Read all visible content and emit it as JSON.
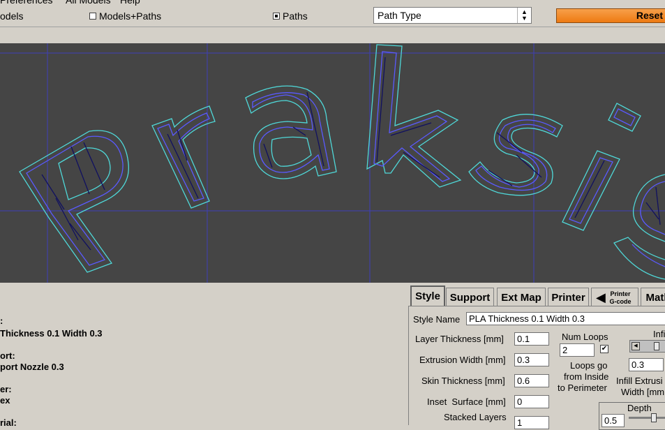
{
  "menu": {
    "items": [
      "Preferences",
      "All Models",
      "Help"
    ]
  },
  "toolbar": {
    "models_label": "odels",
    "models_paths_label": "Models+Paths",
    "paths_label": "Paths",
    "path_type_value": "Path Type",
    "reset_label": "Reset"
  },
  "info": {
    "lines": [
      ":",
      " Thickness 0.1 Width 0.3",
      "ort:",
      "port Nozzle 0.3",
      "er:",
      "ex",
      "rial:"
    ]
  },
  "tabs": [
    {
      "label": "Style"
    },
    {
      "label": "Support"
    },
    {
      "label": "Ext Map"
    },
    {
      "label": "Printer"
    },
    {
      "label": "Printer\nG-code"
    },
    {
      "label": "Math"
    }
  ],
  "style": {
    "style_name_label": "Style Name",
    "style_name_value": "PLA Thickness 0.1 Width 0.3",
    "layer_thickness_label": "Layer Thickness [mm]",
    "layer_thickness_value": "0.1",
    "extrusion_width_label": "Extrusion Width [mm]",
    "extrusion_width_value": "0.3",
    "skin_thickness_label": "Skin Thickness [mm]",
    "skin_thickness_value": "0.6",
    "inset_surface_label": "Inset  Surface [mm]",
    "inset_surface_value": "0",
    "stacked_layers_label": "Stacked Layers",
    "stacked_layers_value": "1",
    "num_loops_label": "Num Loops",
    "num_loops_value": "2",
    "num_loops_checked": true,
    "loops_inside_line1": "Loops go",
    "loops_inside_line2": "from Inside",
    "loops_inside_line3": "to Perimeter",
    "infill_label": "Infi",
    "infill_value": "0.3",
    "infill_extrusion_line1": "Infill Extrusi",
    "infill_extrusion_line2": "Width [mm",
    "depth_label": "Depth",
    "depth_value": "0.5"
  },
  "colors": {
    "viewport_bg": "#454545",
    "grid": "#3c3ce0",
    "outline": "#4fd8d8",
    "inner_loop": "#5a5aff",
    "infill": "#101060",
    "accent_orange": "#ee7a12"
  }
}
